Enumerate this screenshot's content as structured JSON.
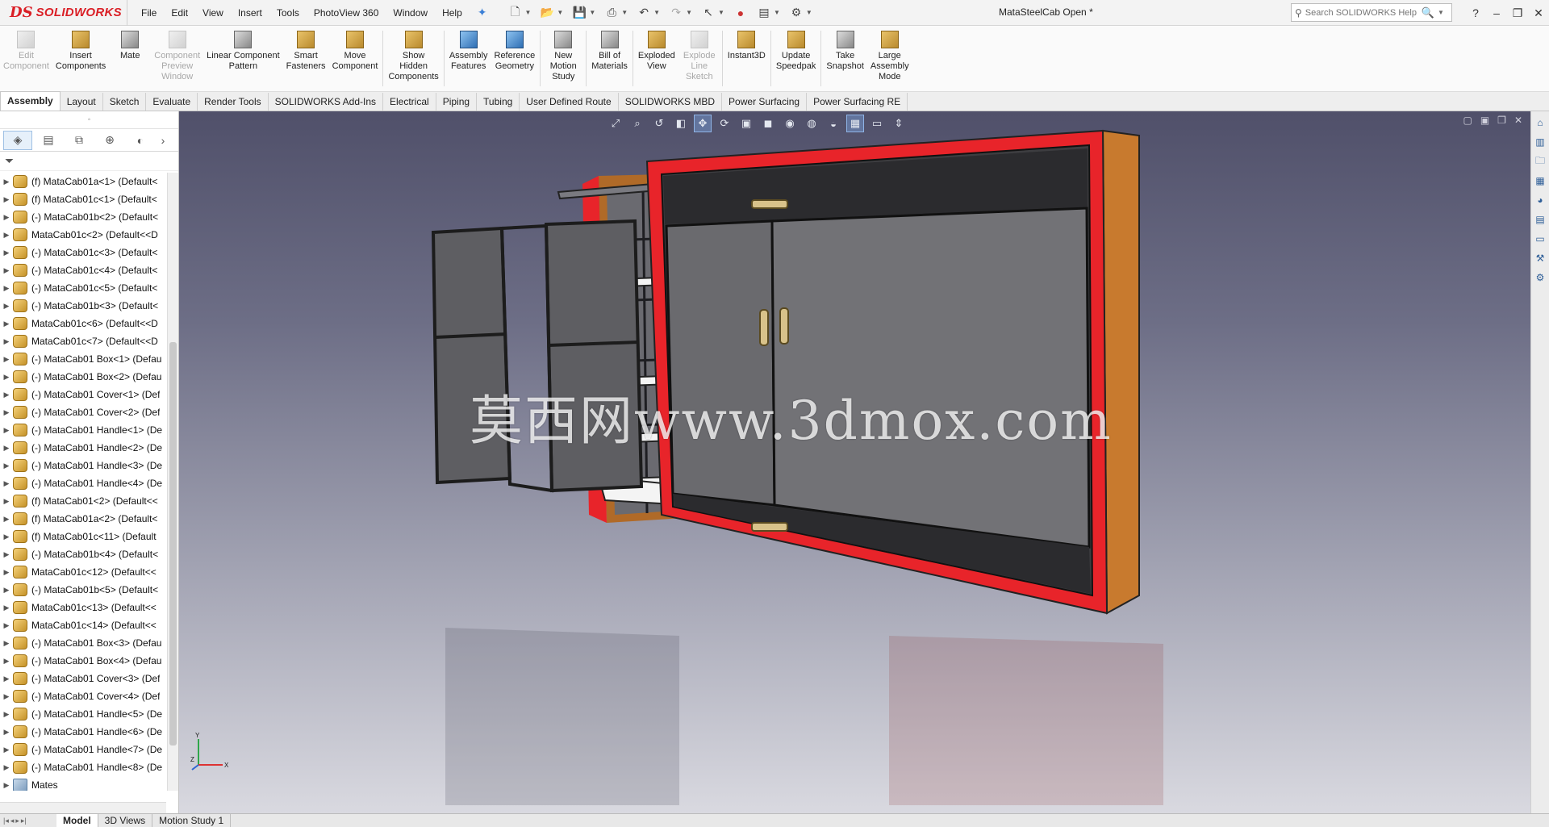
{
  "app": {
    "brand": "SOLIDWORKS",
    "logo_mark": "DS",
    "document_title": "MataSteelCab Open *",
    "menus": [
      "File",
      "Edit",
      "View",
      "Insert",
      "Tools",
      "PhotoView 360",
      "Window",
      "Help"
    ],
    "search_placeholder": "Search SOLIDWORKS Help",
    "window_controls": [
      "?",
      "–",
      "❐",
      "✕"
    ]
  },
  "ribbon": {
    "buttons": [
      {
        "label": "Edit\nComponent",
        "icon": "edit-component-icon",
        "enabled": false
      },
      {
        "label": "Insert\nComponents",
        "icon": "insert-components-icon",
        "enabled": true
      },
      {
        "label": "Mate",
        "icon": "mate-icon",
        "enabled": true
      },
      {
        "label": "Component\nPreview\nWindow",
        "icon": "component-preview-icon",
        "enabled": false
      },
      {
        "label": "Linear Component\nPattern",
        "icon": "linear-pattern-icon",
        "enabled": true
      },
      {
        "label": "Smart\nFasteners",
        "icon": "smart-fasteners-icon",
        "enabled": true
      },
      {
        "label": "Move\nComponent",
        "icon": "move-component-icon",
        "enabled": true
      },
      {
        "label": "Show\nHidden\nComponents",
        "icon": "show-hidden-icon",
        "enabled": true
      },
      {
        "label": "Assembly\nFeatures",
        "icon": "assembly-features-icon",
        "enabled": true
      },
      {
        "label": "Reference\nGeometry",
        "icon": "reference-geometry-icon",
        "enabled": true
      },
      {
        "label": "New\nMotion\nStudy",
        "icon": "motion-study-icon",
        "enabled": true
      },
      {
        "label": "Bill of\nMaterials",
        "icon": "bom-icon",
        "enabled": true
      },
      {
        "label": "Exploded\nView",
        "icon": "exploded-view-icon",
        "enabled": true
      },
      {
        "label": "Explode\nLine\nSketch",
        "icon": "explode-line-icon",
        "enabled": false
      },
      {
        "label": "Instant3D",
        "icon": "instant3d-icon",
        "enabled": true
      },
      {
        "label": "Update\nSpeedpak",
        "icon": "speedpak-icon",
        "enabled": true
      },
      {
        "label": "Take\nSnapshot",
        "icon": "snapshot-icon",
        "enabled": true
      },
      {
        "label": "Large\nAssembly\nMode",
        "icon": "large-assembly-icon",
        "enabled": true
      }
    ]
  },
  "command_tabs": [
    "Assembly",
    "Layout",
    "Sketch",
    "Evaluate",
    "Render Tools",
    "SOLIDWORKS Add-Ins",
    "Electrical",
    "Piping",
    "Tubing",
    "User Defined Route",
    "SOLIDWORKS MBD",
    "Power Surfacing",
    "Power Surfacing RE"
  ],
  "active_command_tab": "Assembly",
  "feature_tree": {
    "items": [
      "(f) MataCab01a<1> (Default<",
      "(f) MataCab01c<1> (Default<",
      "(-) MataCab01b<2> (Default<",
      "MataCab01c<2> (Default<<D",
      "(-) MataCab01c<3> (Default<",
      "(-) MataCab01c<4> (Default<",
      "(-) MataCab01c<5> (Default<",
      "(-) MataCab01b<3> (Default<",
      "MataCab01c<6> (Default<<D",
      "MataCab01c<7> (Default<<D",
      "(-) MataCab01 Box<1> (Defau",
      "(-) MataCab01 Box<2> (Defau",
      "(-) MataCab01 Cover<1> (Def",
      "(-) MataCab01 Cover<2> (Def",
      "(-) MataCab01 Handle<1> (De",
      "(-) MataCab01 Handle<2> (De",
      "(-) MataCab01 Handle<3> (De",
      "(-) MataCab01 Handle<4> (De",
      "(f) MataCab01<2> (Default<<",
      "(f) MataCab01a<2> (Default<",
      "(f) MataCab01c<11> (Default",
      "(-) MataCab01b<4> (Default<",
      "MataCab01c<12> (Default<<",
      "(-) MataCab01b<5> (Default<",
      "MataCab01c<13> (Default<<",
      "MataCab01c<14> (Default<<",
      "(-) MataCab01 Box<3> (Defau",
      "(-) MataCab01 Box<4> (Defau",
      "(-) MataCab01 Cover<3> (Def",
      "(-) MataCab01 Cover<4> (Def",
      "(-) MataCab01 Handle<5> (De",
      "(-) MataCab01 Handle<6> (De",
      "(-) MataCab01 Handle<7> (De",
      "(-) MataCab01 Handle<8> (De"
    ],
    "mates_label": "Mates"
  },
  "viewport": {
    "watermark": "莫西网www.3dmox.com",
    "triad": {
      "x": "X",
      "y": "Y",
      "z": "Z"
    },
    "colors": {
      "frame_red": "#e8242a",
      "side_wood": "#c87a2e",
      "panel_grey": "#6a6a6e",
      "shelf_white": "#f4f4f4"
    }
  },
  "bottom_tabs": [
    "Model",
    "3D Views",
    "Motion Study 1"
  ],
  "active_bottom_tab": "Model"
}
